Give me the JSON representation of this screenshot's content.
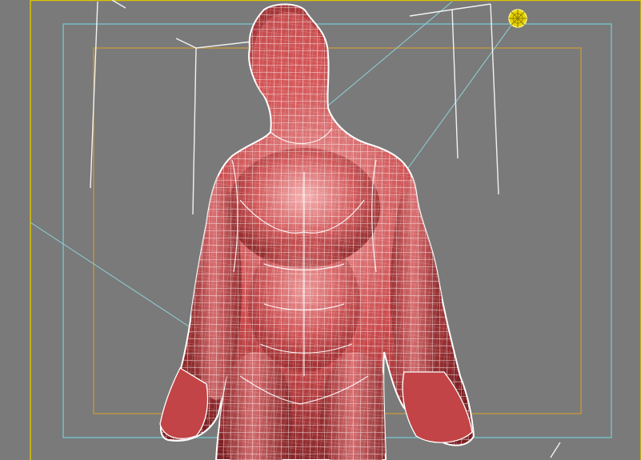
{
  "viewport": {
    "background_color": "#7a7a7a",
    "frame_color": "#d9c200",
    "safe_frame_color": "#73c8cf",
    "render_region_color": "#c79a3a",
    "wire_color": "#ffffff",
    "light_color": "#ffe300",
    "light_icon": "omni-light-icon"
  },
  "model": {
    "skin_color": "#c94a4c",
    "skin_highlight": "#f2a3a3",
    "skin_shadow": "#7a1f22",
    "wireframe_color": "#ffffff"
  }
}
